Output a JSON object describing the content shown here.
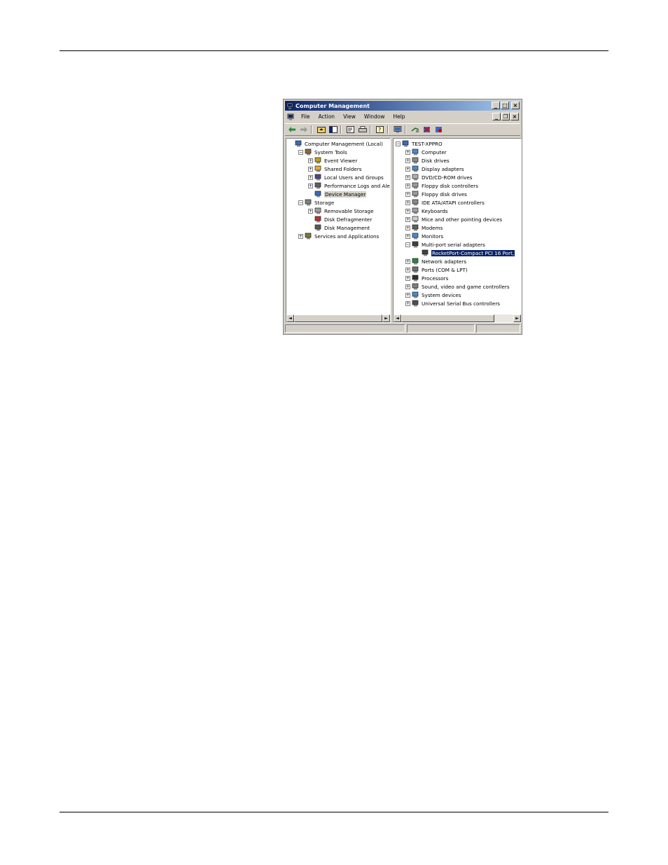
{
  "window": {
    "title": "Computer Management",
    "controls": {
      "minimize": "_",
      "maximize": "□",
      "close": "×"
    }
  },
  "menubar": {
    "items": [
      "File",
      "Action",
      "View",
      "Window",
      "Help"
    ],
    "mdi_controls": {
      "minimize": "_",
      "restore": "❐",
      "close": "×"
    }
  },
  "toolbar": {
    "buttons": [
      "back-icon",
      "forward-icon",
      "up-folder-icon",
      "show-hide-tree-icon",
      "properties-icon",
      "print-icon",
      "help-icon",
      "device-manager-icon",
      "scan-hardware-icon",
      "uninstall-icon",
      "disable-icon"
    ]
  },
  "left_tree": [
    {
      "label": "Computer Management (Local)",
      "level": 0,
      "expander": "none",
      "icon": "computer-icon"
    },
    {
      "label": "System Tools",
      "level": 1,
      "expander": "−",
      "icon": "system-tools-icon"
    },
    {
      "label": "Event Viewer",
      "level": 2,
      "expander": "+",
      "icon": "event-viewer-icon"
    },
    {
      "label": "Shared Folders",
      "level": 2,
      "expander": "+",
      "icon": "shared-folders-icon"
    },
    {
      "label": "Local Users and Groups",
      "level": 2,
      "expander": "+",
      "icon": "users-icon"
    },
    {
      "label": "Performance Logs and Alerts",
      "level": 2,
      "expander": "+",
      "icon": "performance-icon"
    },
    {
      "label": "Device Manager",
      "level": 2,
      "expander": "none",
      "icon": "device-manager-icon",
      "state": "highlighted"
    },
    {
      "label": "Storage",
      "level": 1,
      "expander": "−",
      "icon": "storage-icon"
    },
    {
      "label": "Removable Storage",
      "level": 2,
      "expander": "+",
      "icon": "removable-storage-icon"
    },
    {
      "label": "Disk Defragmenter",
      "level": 2,
      "expander": "none",
      "icon": "defrag-icon"
    },
    {
      "label": "Disk Management",
      "level": 2,
      "expander": "none",
      "icon": "disk-management-icon"
    },
    {
      "label": "Services and Applications",
      "level": 1,
      "expander": "+",
      "icon": "services-icon"
    }
  ],
  "right_tree": [
    {
      "label": "TEST-XPPRO",
      "level": 0,
      "expander": "−",
      "icon": "computer-icon"
    },
    {
      "label": "Computer",
      "level": 1,
      "expander": "+",
      "icon": "computer-device-icon"
    },
    {
      "label": "Disk drives",
      "level": 1,
      "expander": "+",
      "icon": "disk-drive-icon"
    },
    {
      "label": "Display adapters",
      "level": 1,
      "expander": "+",
      "icon": "display-adapter-icon"
    },
    {
      "label": "DVD/CD-ROM drives",
      "level": 1,
      "expander": "+",
      "icon": "cdrom-icon"
    },
    {
      "label": "Floppy disk controllers",
      "level": 1,
      "expander": "+",
      "icon": "floppy-controller-icon"
    },
    {
      "label": "Floppy disk drives",
      "level": 1,
      "expander": "+",
      "icon": "floppy-drive-icon"
    },
    {
      "label": "IDE ATA/ATAPI controllers",
      "level": 1,
      "expander": "+",
      "icon": "ide-controller-icon"
    },
    {
      "label": "Keyboards",
      "level": 1,
      "expander": "+",
      "icon": "keyboard-icon"
    },
    {
      "label": "Mice and other pointing devices",
      "level": 1,
      "expander": "+",
      "icon": "mouse-icon"
    },
    {
      "label": "Modems",
      "level": 1,
      "expander": "+",
      "icon": "modem-icon"
    },
    {
      "label": "Monitors",
      "level": 1,
      "expander": "+",
      "icon": "monitor-icon"
    },
    {
      "label": "Multi-port serial adapters",
      "level": 1,
      "expander": "−",
      "icon": "serial-adapter-icon"
    },
    {
      "label": "RocketPort-Compact PCI 16 Port,",
      "level": 2,
      "expander": "none",
      "icon": "serial-port-icon",
      "state": "selected"
    },
    {
      "label": "Network adapters",
      "level": 1,
      "expander": "+",
      "icon": "network-adapter-icon"
    },
    {
      "label": "Ports (COM & LPT)",
      "level": 1,
      "expander": "+",
      "icon": "ports-icon"
    },
    {
      "label": "Processors",
      "level": 1,
      "expander": "+",
      "icon": "processor-icon"
    },
    {
      "label": "Sound, video and game controllers",
      "level": 1,
      "expander": "+",
      "icon": "sound-icon"
    },
    {
      "label": "System devices",
      "level": 1,
      "expander": "+",
      "icon": "system-devices-icon"
    },
    {
      "label": "Universal Serial Bus controllers",
      "level": 1,
      "expander": "+",
      "icon": "usb-icon"
    }
  ],
  "scroll_arrows": {
    "left": "◄",
    "right": "►"
  },
  "colors": {
    "title_start": "#0a246a",
    "title_end": "#a6caf0",
    "selection": "#0a246a",
    "face": "#d4d0c8"
  }
}
